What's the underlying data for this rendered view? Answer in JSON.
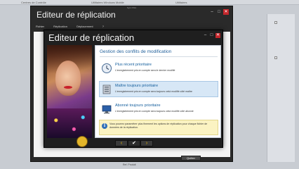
{
  "desktop": {
    "tabs": [
      "Centres de Contrôle",
      "Utilitaires Windows Mobile",
      "Utilitaires"
    ],
    "panel_label": "Paramètres"
  },
  "app": {
    "caption": "Sync Pilot",
    "title": "Editeur de réplication",
    "menu": [
      "Fichier",
      "Réplication",
      "Déplacement",
      "?"
    ],
    "quit_label": "Quitter",
    "bottom_label": "Ref. Produit"
  },
  "dialog": {
    "title": "Editeur de réplication",
    "heading": "Gestion des conflits de modification",
    "options": [
      {
        "title": "Plus récent prioritaire",
        "description": "L'enregistrement pris en compte sera le dernier modifié",
        "icon": "clock-icon",
        "selected": false
      },
      {
        "title": "Maître toujours prioritaire",
        "description": "L'enregistrement pris en compte sera toujours celui modifié côté maître",
        "icon": "server-icon",
        "selected": true
      },
      {
        "title": "Abonné toujours prioritaire",
        "description": "L'enregistrement pris en compte sera toujours celui modifié côté abonné",
        "icon": "computer-icon",
        "selected": false
      }
    ],
    "info_text": "Vous pourrez paramétrer plus finement les options de réplication pour chaque fichier de données de la réplication.",
    "nav": {
      "prev": "‹",
      "ok": "✔",
      "next": "›"
    }
  },
  "colors": {
    "accent": "#1f5f9a",
    "selected_bg": "#d7e7f6",
    "info_bg": "#fbf3c2",
    "close_red": "#c4262b",
    "nav_yellow": "#f0c000"
  }
}
